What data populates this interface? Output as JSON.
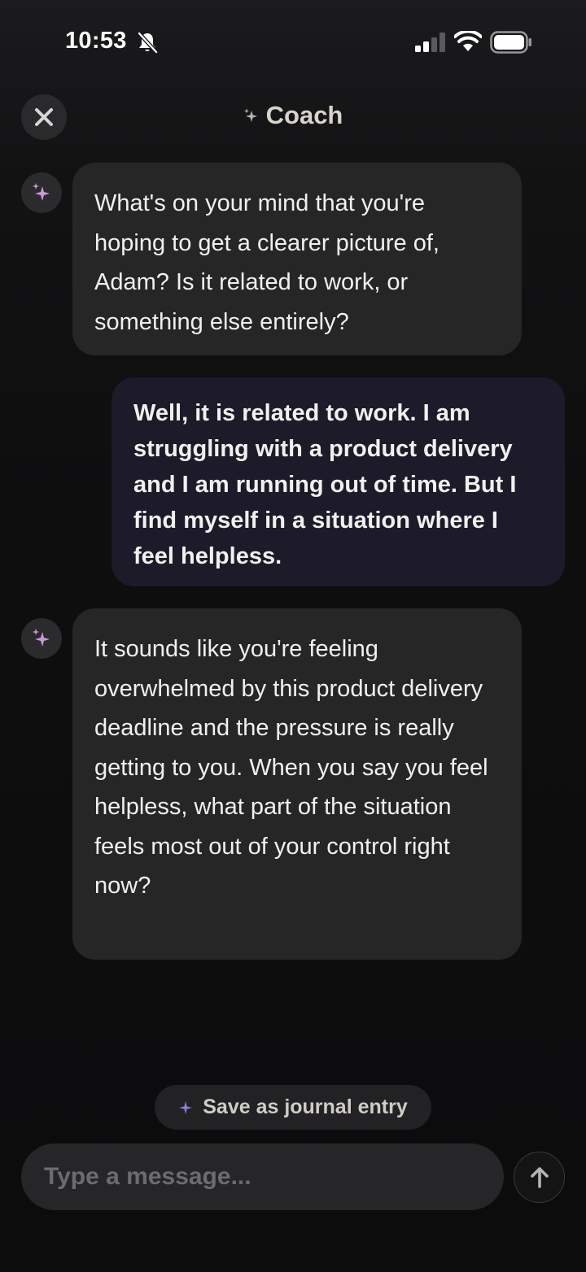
{
  "status_bar": {
    "time": "10:53",
    "icons": [
      "bell-slash-icon",
      "cellular-signal-icon",
      "wifi-icon",
      "battery-icon"
    ]
  },
  "header": {
    "title": "Coach",
    "close_icon": "close-icon",
    "title_icon": "sparkle-icon"
  },
  "messages": [
    {
      "role": "assistant",
      "avatar_icon": "sparkle-icon",
      "text": "What's on your mind that you're hoping to get a clearer picture of, Adam? Is it related to work, or something else entirely?"
    },
    {
      "role": "user",
      "text": "Well, it is related to work. I am struggling with a product delivery and I am running out of time. But I find myself in a situation where I feel helpless."
    },
    {
      "role": "assistant",
      "avatar_icon": "sparkle-icon",
      "text": "It sounds like you're feeling overwhelmed by this product delivery deadline and the pressure is really getting to you. When you say you feel helpless, what part of the situation feels most out of your control right now?"
    }
  ],
  "actions": {
    "save_journal_label": "Save as journal entry",
    "save_journal_icon": "sparkle-icon"
  },
  "composer": {
    "placeholder": "Type a message...",
    "value": "",
    "send_icon": "arrow-up-icon"
  },
  "colors": {
    "background": "#0e0e0f",
    "assistant_bubble": "#262626",
    "user_bubble": "#1d1a29",
    "accent_sparkle": "#c89ad6",
    "journal_sparkle": "#8c7fd9"
  }
}
